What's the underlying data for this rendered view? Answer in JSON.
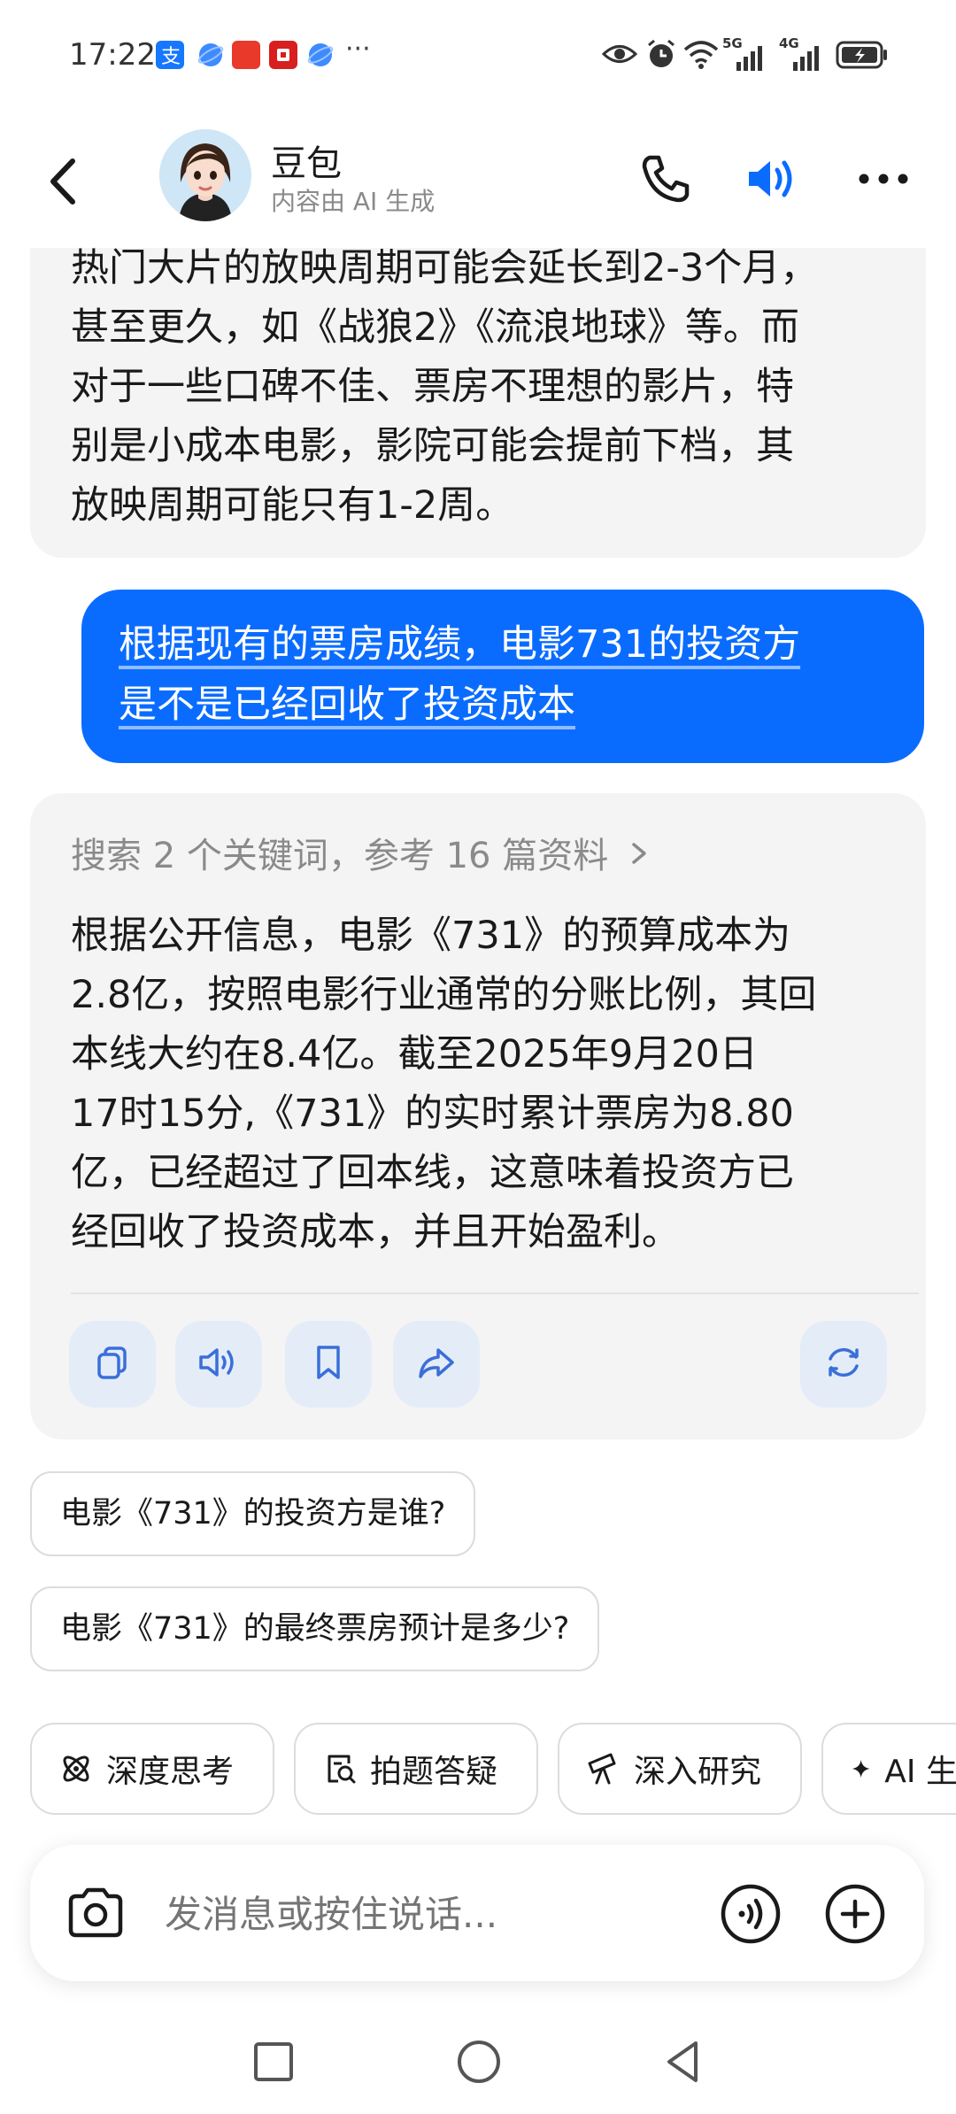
{
  "status_bar": {
    "time": "17:22",
    "dots": "···",
    "net_5g": "5G",
    "net_4g": "4G"
  },
  "header": {
    "name": "豆包",
    "subtitle": "内容由 AI 生成"
  },
  "prev_answer": {
    "lines": [
      "热门大片的放映周期可能会延长到2-3个月，",
      "甚至更久，如《战狼2》《流浪地球》等。而",
      "对于一些口碑不佳、票房不理想的影片，特",
      "别是小成本电影，影院可能会提前下档，其",
      "放映周期可能只有1-2周。"
    ]
  },
  "user_message": {
    "lines": [
      "根据现有的票房成绩，电影731的投资方",
      "是不是已经回收了投资成本"
    ]
  },
  "answer": {
    "search_summary": "搜索 2 个关键词，参考 16 篇资料",
    "lines": [
      "根据公开信息，电影《731》的预算成本为",
      "2.8亿，按照电影行业通常的分账比例，其回",
      "本线大约在8.4亿。截至2025年9月20日",
      "17时15分,《731》的实时累计票房为8.80",
      "亿，已经超过了回本线，这意味着投资方已",
      "经回收了投资成本，并且开始盈利。"
    ]
  },
  "suggestions": [
    "电影《731》的投资方是谁?",
    "电影《731》的最终票房预计是多少?"
  ],
  "tools": [
    {
      "label": "深度思考",
      "icon": "atom-icon"
    },
    {
      "label": "拍题答疑",
      "icon": "photo-search-icon"
    },
    {
      "label": "深入研究",
      "icon": "telescope-icon"
    },
    {
      "label": "AI 生",
      "icon": "sparkle-icon"
    }
  ],
  "input": {
    "placeholder": "发消息或按住说话..."
  },
  "colors": {
    "accent": "#0a6cff",
    "bubble_bg": "#f4f4f5",
    "action_bg": "#e4ecf8"
  }
}
